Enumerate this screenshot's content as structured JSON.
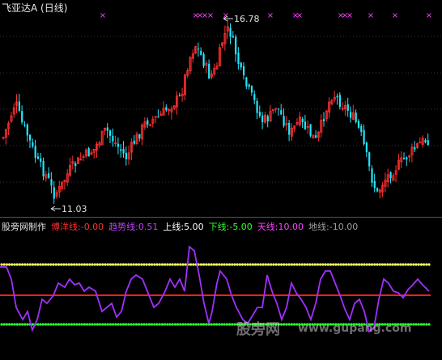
{
  "header": {
    "title": "飞亚达A (日线)"
  },
  "price_panel": {
    "high_label": "16.78",
    "low_label": "11.03",
    "marker_glyph": "×"
  },
  "indicator_bar": {
    "name": "股旁网制作",
    "items": [
      {
        "label": "博洋线:",
        "value": "-0.00",
        "color": "#ff3030"
      },
      {
        "label": "趋势线:",
        "value": "0.51",
        "color": "#c040ff"
      },
      {
        "label": "上线:",
        "value": "5.00",
        "color": "#ffffff"
      },
      {
        "label": "下线:",
        "value": "-5.00",
        "color": "#30ff30"
      },
      {
        "label": "天线:",
        "value": "10.00",
        "color": "#ff40ff"
      },
      {
        "label": "地线:",
        "value": "-10.00",
        "color": "#a0a0a0"
      }
    ]
  },
  "watermark": {
    "text_cn": "股旁网",
    "text_en": "www.gupang.com"
  },
  "colors": {
    "up": "#ff3030",
    "down": "#20e8ff",
    "trend": "#a030ff",
    "upper": "#ffff60",
    "lower": "#30ff30",
    "mid": "#ff2020",
    "marker": "#ff40ff",
    "grid": "#333333"
  }
}
